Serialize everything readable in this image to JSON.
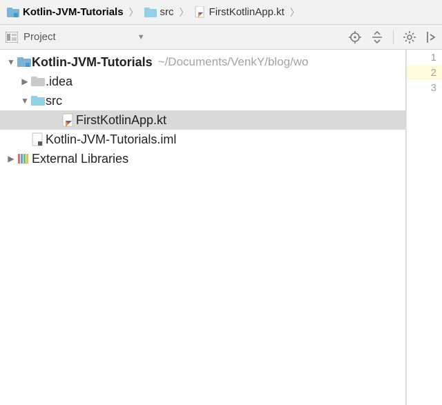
{
  "breadcrumb": {
    "project": "Kotlin-JVM-Tutorials",
    "src": "src",
    "file": "FirstKotlinApp.kt"
  },
  "toolbar": {
    "view_label": "Project"
  },
  "tree": {
    "project_name": "Kotlin-JVM-Tutorials",
    "project_path": "~/Documents/VenkY/blog/wo",
    "idea_folder": ".idea",
    "src_folder": "src",
    "selected_file": "FirstKotlinApp.kt",
    "iml_file": "Kotlin-JVM-Tutorials.iml",
    "external_libs": "External Libraries"
  },
  "editor": {
    "lines": [
      "1",
      "2",
      "3"
    ],
    "highlighted_line_index": 1
  }
}
